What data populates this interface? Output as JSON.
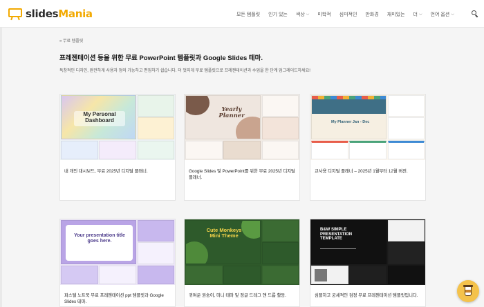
{
  "brand": {
    "name_part1": "slides",
    "name_part2": "Mania",
    "accent": "#f2a900"
  },
  "nav": {
    "items": [
      {
        "label": "모든 템플릿",
        "has_menu": false
      },
      {
        "label": "인기 있는",
        "has_menu": false
      },
      {
        "label": "색상",
        "has_menu": true
      },
      {
        "label": "미학적",
        "has_menu": false
      },
      {
        "label": "심미적인",
        "has_menu": false
      },
      {
        "label": "만화경",
        "has_menu": false
      },
      {
        "label": "재미있는",
        "has_menu": false
      },
      {
        "label": "더",
        "has_menu": true
      },
      {
        "label": "언어 옵션",
        "has_menu": true
      }
    ],
    "search_icon": "search-icon"
  },
  "breadcrumb": "» 무료 템플릿",
  "page": {
    "title": "프레젠테이션 등을 위한 무료 PowerPoint 템플릿과 Google Slides 테마.",
    "description": "독창적인 디자인, 완전하게 사용자 정의 가능하고 편집하기 쉽습니다. 더 멋지게 무료 템플릿으로 프레젠테이션과 수업을 한 단계 업그레이드하세요!"
  },
  "cards": [
    {
      "title": "내 개인 대시보드, 무료 2025년 디지털 플래너.",
      "thumb_text": "My Personal Dashboard"
    },
    {
      "title": "Google Slides 및 PowerPoint를 위한 무료 2025년 디지털 플래너.",
      "thumb_text": "Yearly Planner"
    },
    {
      "title": "교사용 디지털 플래너 – 2025년 1월부터 12월 버전.",
      "thumb_text": "My Planner Jan - Dec"
    },
    {
      "title": "파스텔 노트북 무료 프레젠테이션 ppt 템플릿과 Google Slides 테마.",
      "thumb_text": "Your presentation title goes here."
    },
    {
      "title": "귀여운 원숭이, 미니 테마 및 정글 드레그 앤 드롭 활동.",
      "thumb_text": "Cute Monkeys Mini Theme"
    },
    {
      "title": "심플하고 궁세적인 검정 무료 프레젠테이션 템플릿입니다.",
      "thumb_text": "B&W SIMPLE PRESENTATION TEMPLATE"
    }
  ],
  "coffee_button": {
    "icon": "coffee-cup-icon"
  }
}
